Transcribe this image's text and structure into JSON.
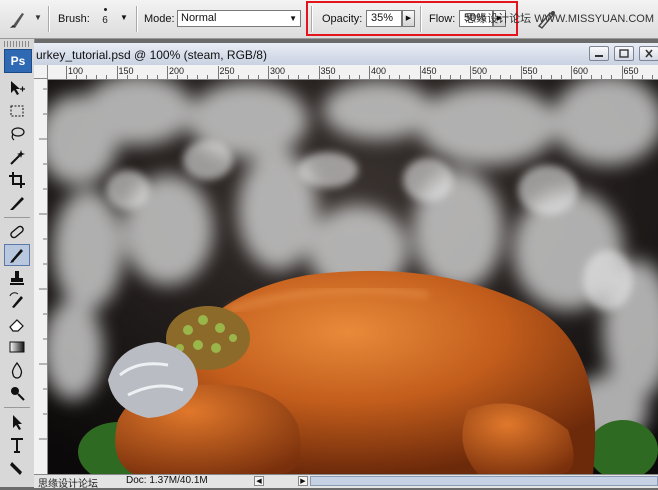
{
  "options_bar": {
    "brush_label": "Brush:",
    "brush_size": "6",
    "mode_label": "Mode:",
    "mode_value": "Normal",
    "opacity_label": "Opacity:",
    "opacity_value": "35%",
    "flow_label": "Flow:",
    "flow_value": "50%",
    "watermark": "思缘设计论坛 WWW.MISSYUAN.COM",
    "highlight_color": "#e3141b"
  },
  "toolbox": {
    "logo": "Ps",
    "tools": [
      "move-icon",
      "marquee-icon",
      "lasso-icon",
      "magic-wand-icon",
      "crop-icon",
      "slice-icon",
      "healing-icon",
      "brush-icon",
      "stamp-icon",
      "history-brush-icon",
      "eraser-icon",
      "gradient-icon",
      "blur-icon",
      "dodge-icon",
      "path-select-icon",
      "type-icon",
      "pen-icon"
    ],
    "active_tool": "brush-icon"
  },
  "document": {
    "title": "urkey_tutorial.psd @ 100% (steam, RGB/8)",
    "ruler_labels": [
      "100",
      "150",
      "200",
      "250",
      "300",
      "350",
      "400",
      "450",
      "500",
      "550",
      "600",
      "650"
    ]
  },
  "status_bar": {
    "watermark": "思缘设计论坛",
    "doc_info": "Doc: 1.37M/40.1M"
  }
}
